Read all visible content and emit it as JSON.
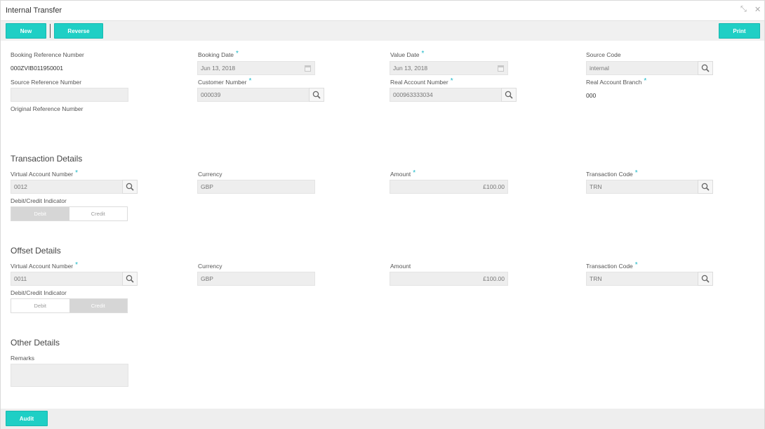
{
  "window": {
    "title": "Internal Transfer",
    "minimize_glyph": "⤡",
    "close_glyph": "✕"
  },
  "toolbar": {
    "new_label": "New",
    "reverse_label": "Reverse",
    "print_label": "Print"
  },
  "main": {
    "booking_ref": {
      "label": "Booking Reference Number",
      "value": "000ZVIB011950001"
    },
    "booking_date": {
      "label": "Booking Date",
      "value": "Jun 13, 2018"
    },
    "value_date": {
      "label": "Value Date",
      "value": "Jun 13, 2018"
    },
    "source_code": {
      "label": "Source Code",
      "value": "internal"
    },
    "source_ref": {
      "label": "Source Reference Number",
      "value": ""
    },
    "customer_number": {
      "label": "Customer Number",
      "value": "000039"
    },
    "real_account_number": {
      "label": "Real Account Number",
      "value": "000963333034"
    },
    "real_account_branch": {
      "label": "Real Account Branch",
      "value": "000"
    },
    "original_ref": {
      "label": "Original Reference Number"
    }
  },
  "required_mark": "*",
  "transaction": {
    "heading": "Transaction Details",
    "virtual_account": {
      "label": "Virtual Account Number",
      "value": "0012"
    },
    "currency": {
      "label": "Currency",
      "value": "GBP"
    },
    "amount": {
      "label": "Amount",
      "value": "£100.00"
    },
    "transaction_code": {
      "label": "Transaction Code",
      "value": "TRN"
    },
    "indicator": {
      "label": "Debit/Credit Indicator",
      "debit": "Debit",
      "credit": "Credit",
      "selected": "Debit"
    }
  },
  "offset": {
    "heading": "Offset Details",
    "virtual_account": {
      "label": "Virtual Account Number",
      "value": "0011"
    },
    "currency": {
      "label": "Currency",
      "value": "GBP"
    },
    "amount": {
      "label": "Amount",
      "value": "£100.00"
    },
    "transaction_code": {
      "label": "Transaction Code",
      "value": "TRN"
    },
    "indicator": {
      "label": "Debit/Credit Indicator",
      "debit": "Debit",
      "credit": "Credit",
      "selected": "Credit"
    }
  },
  "other": {
    "heading": "Other Details",
    "remarks": {
      "label": "Remarks",
      "value": ""
    }
  },
  "footer": {
    "audit_label": "Audit"
  },
  "colors": {
    "accent": "#1fcfc5",
    "required": "#1ab7c7",
    "field_bg": "#eeeeee"
  },
  "icons": {
    "search": "search-icon",
    "calendar": "calendar-icon"
  }
}
